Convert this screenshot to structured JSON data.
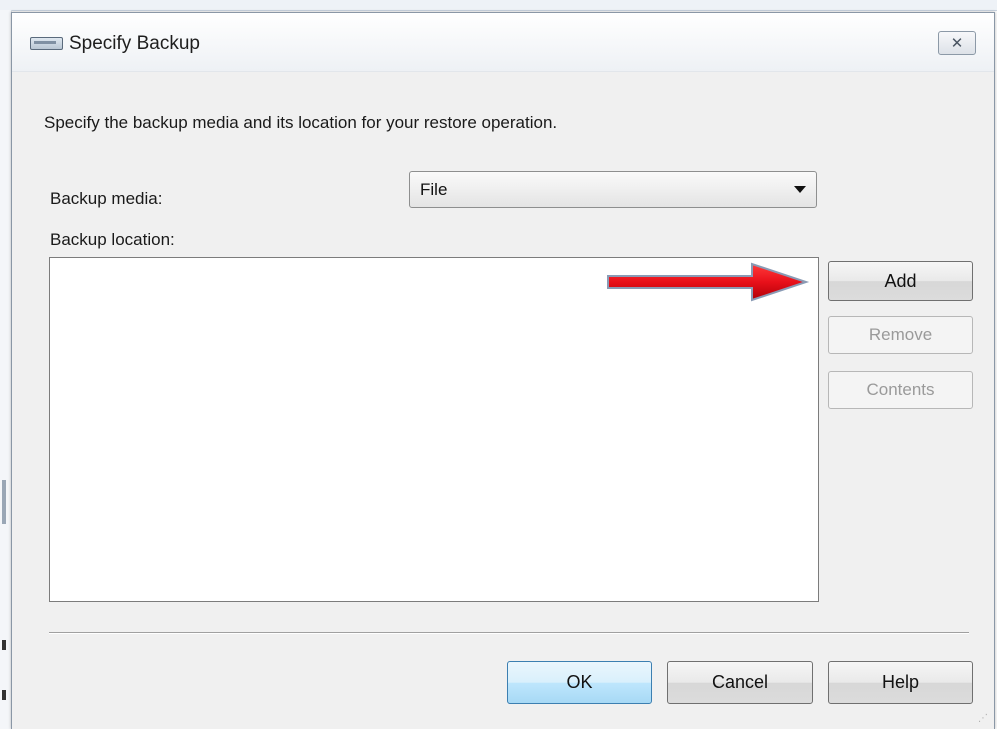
{
  "dialog": {
    "title": "Specify Backup",
    "close_symbol": "✕",
    "instruction": "Specify the backup media and its location for your restore operation.",
    "backup_media": {
      "label": "Backup media:",
      "selected": "File"
    },
    "backup_location": {
      "label": "Backup location:",
      "items": []
    },
    "side_buttons": {
      "add": "Add",
      "remove": "Remove",
      "contents": "Contents"
    },
    "footer_buttons": {
      "ok": "OK",
      "cancel": "Cancel",
      "help": "Help"
    }
  },
  "annotation": {
    "arrow_color": "#e8101a",
    "arrow_points_to": "add-button"
  },
  "icons": {
    "title_icon": "backup-device-icon",
    "close_icon": "close-icon",
    "dropdown_icon": "chevron-down-icon",
    "grip_icon": "resize-grip-icon"
  }
}
